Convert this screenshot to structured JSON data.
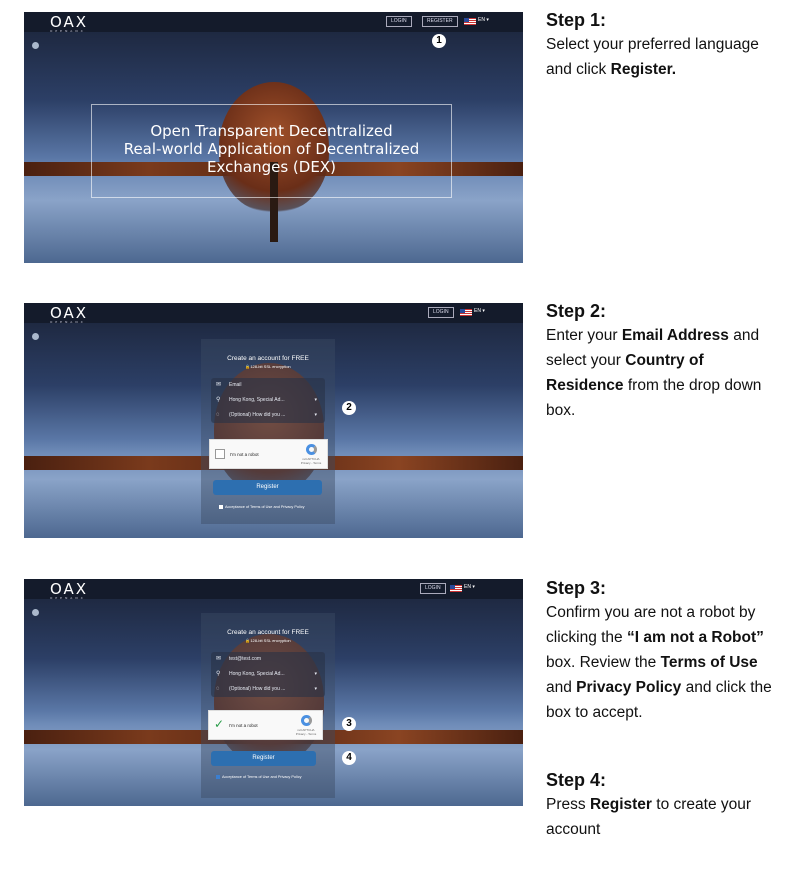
{
  "app": {
    "logo": "OAX",
    "logo_sub": "OPENANX",
    "login": "LOGIN",
    "register": "REGISTER",
    "lang": "EN ▾"
  },
  "hero": {
    "line1": "Open Transparent Decentralized",
    "line2": "Real-world Application of Decentralized",
    "line3": "Exchanges (DEX)"
  },
  "form": {
    "title": "Create an account for FREE",
    "encryption": "🔒128-bit SSL encryption",
    "email_placeholder": "Email",
    "email_value": "test@test.com",
    "country": "Hong Kong, Special Ad...",
    "referral": "(Optional) How did you ...",
    "captcha": "I'm not a robot",
    "recaptcha": "reCAPTCHA",
    "recaptcha_links": "Privacy - Terms",
    "register": "Register",
    "terms": "Acceptance of Terms of Use and Privacy Policy"
  },
  "badges": [
    "1",
    "2",
    "3",
    "4"
  ],
  "steps": [
    {
      "title": "Step 1:",
      "parts": [
        "Select your preferred language and click ",
        "Register."
      ]
    },
    {
      "title": "Step 2:",
      "parts": [
        "Enter your ",
        "Email Address",
        " and select your ",
        "Country of Residence",
        " from the drop down box."
      ]
    },
    {
      "title": "Step 3:",
      "parts": [
        "Confirm you are not a robot by clicking the ",
        "“I am not a Robot”",
        " box. Review the ",
        "Terms of Use",
        " and ",
        "Privacy Policy",
        " and click the box to accept."
      ]
    },
    {
      "title": "Step 4:",
      "parts": [
        "Press ",
        "Register",
        " to create your account"
      ]
    }
  ],
  "colors": {
    "register_button": "#2d6fb0",
    "nav": "#141b2b",
    "checkmark": "#2a9d4a"
  }
}
